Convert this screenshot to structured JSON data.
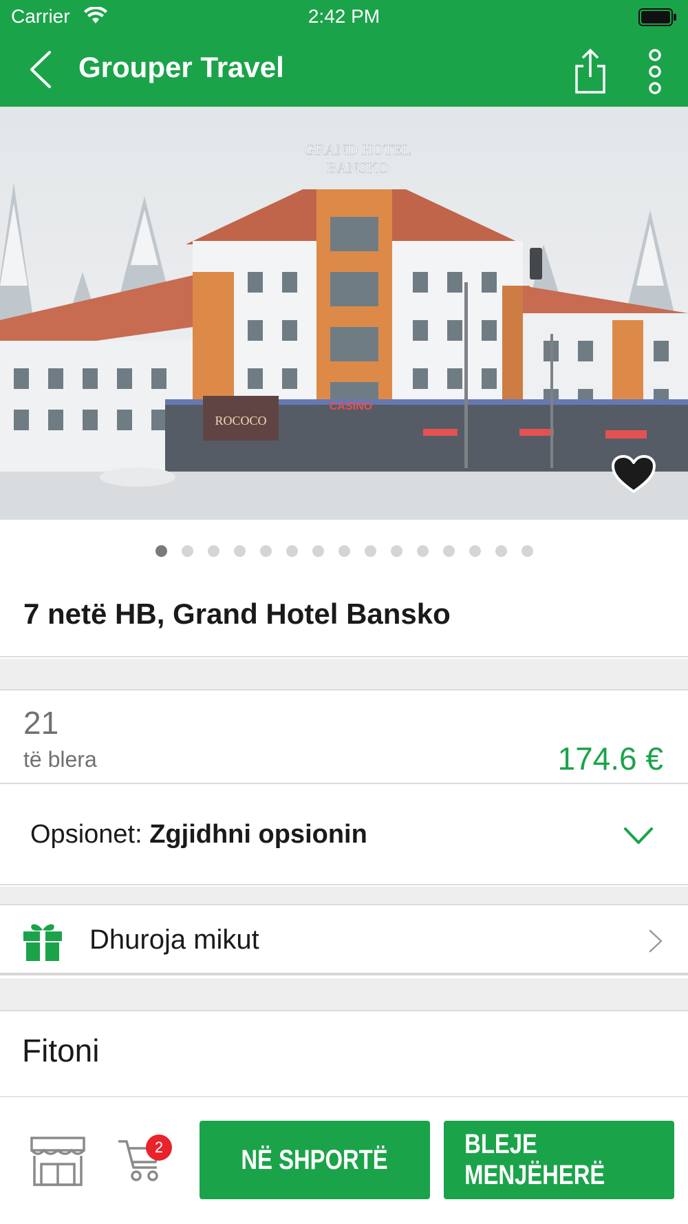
{
  "status_bar": {
    "carrier": "Carrier",
    "time": "2:42 PM"
  },
  "nav": {
    "title": "Grouper Travel"
  },
  "hero": {
    "slide_count": 15,
    "active_slide": 1,
    "sign_line1": "GRAND HOTEL",
    "sign_line2": "BANSKO",
    "casino_text": "CASINO",
    "rococo_text": "ROCOCO"
  },
  "product": {
    "title": "7 netë HB, Grand Hotel Bansko"
  },
  "stats": {
    "sold_count": "21",
    "sold_label": "të blera",
    "price": "174.6 €"
  },
  "options": {
    "label": "Opsionet: ",
    "value": "Zgjidhni opsionin"
  },
  "gift": {
    "label": "Dhuroja mikut"
  },
  "section": {
    "title": "Fitoni"
  },
  "bottom": {
    "cart_badge": "2",
    "add_to_cart": "NË SHPORTË",
    "buy_now": "BLEJE MENJËHERË"
  },
  "colors": {
    "brand_green": "#1ba34a",
    "badge_red": "#e8232b"
  },
  "icons": [
    "back-arrow-icon",
    "share-icon",
    "more-vertical-icon",
    "heart-icon",
    "chevron-down-icon",
    "gift-icon",
    "chevron-right-icon",
    "store-icon",
    "cart-icon",
    "wifi-icon",
    "battery-icon"
  ]
}
